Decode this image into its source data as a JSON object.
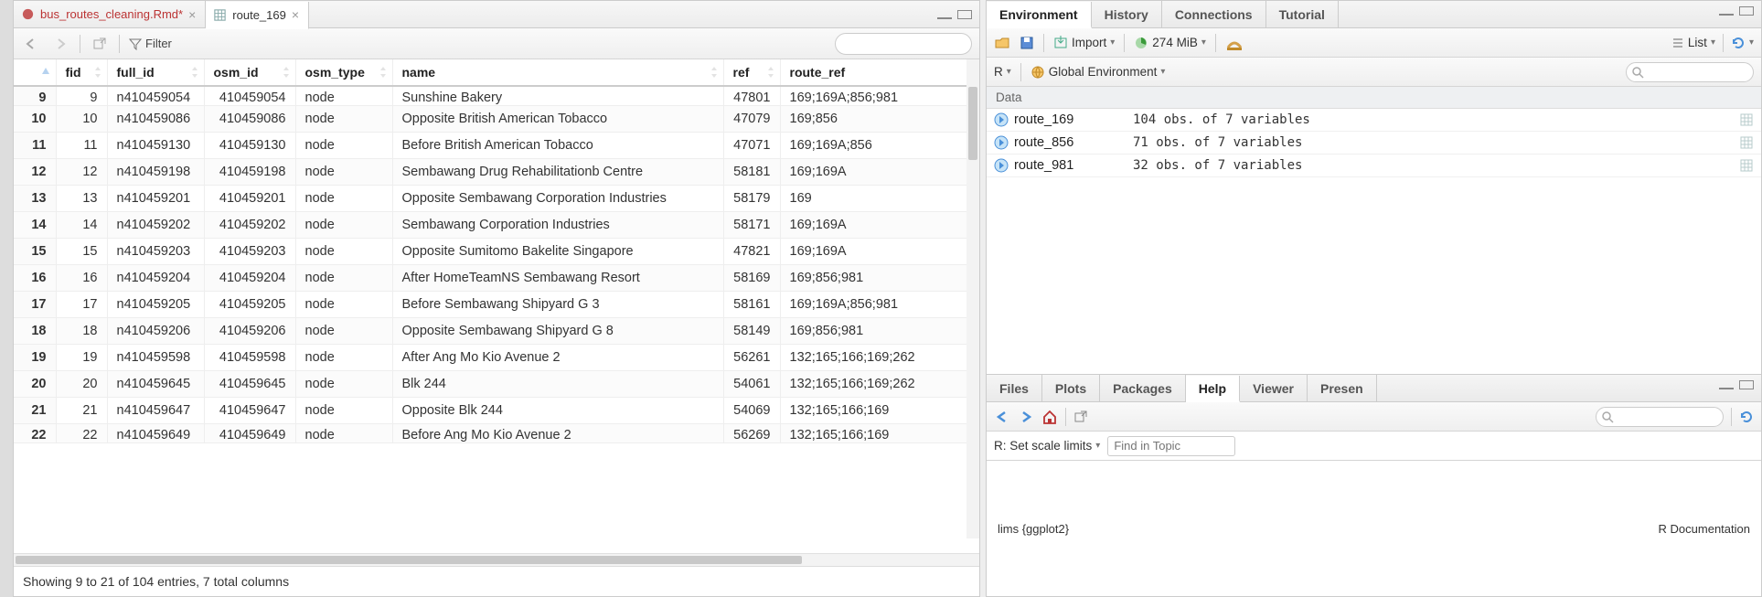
{
  "tabs": {
    "inactive_label": "bus_routes_cleaning.Rmd*",
    "active_label": "route_169"
  },
  "toolbar": {
    "filter_label": "Filter"
  },
  "table": {
    "columns": [
      "fid",
      "full_id",
      "osm_id",
      "osm_type",
      "name",
      "ref",
      "route_ref"
    ],
    "rows": [
      {
        "rn": "9",
        "fid": "9",
        "full_id": "n410459054",
        "osm_id": "410459054",
        "osm_type": "node",
        "name": "Sunshine Bakery",
        "ref": "47801",
        "route_ref": "169;169A;856;981"
      },
      {
        "rn": "10",
        "fid": "10",
        "full_id": "n410459086",
        "osm_id": "410459086",
        "osm_type": "node",
        "name": "Opposite British American Tobacco",
        "ref": "47079",
        "route_ref": "169;856"
      },
      {
        "rn": "11",
        "fid": "11",
        "full_id": "n410459130",
        "osm_id": "410459130",
        "osm_type": "node",
        "name": "Before British American Tobacco",
        "ref": "47071",
        "route_ref": "169;169A;856"
      },
      {
        "rn": "12",
        "fid": "12",
        "full_id": "n410459198",
        "osm_id": "410459198",
        "osm_type": "node",
        "name": "Sembawang Drug Rehabilitationb Centre",
        "ref": "58181",
        "route_ref": "169;169A"
      },
      {
        "rn": "13",
        "fid": "13",
        "full_id": "n410459201",
        "osm_id": "410459201",
        "osm_type": "node",
        "name": "Opposite Sembawang Corporation Industries",
        "ref": "58179",
        "route_ref": "169"
      },
      {
        "rn": "14",
        "fid": "14",
        "full_id": "n410459202",
        "osm_id": "410459202",
        "osm_type": "node",
        "name": "Sembawang Corporation Industries",
        "ref": "58171",
        "route_ref": "169;169A"
      },
      {
        "rn": "15",
        "fid": "15",
        "full_id": "n410459203",
        "osm_id": "410459203",
        "osm_type": "node",
        "name": "Opposite Sumitomo Bakelite Singapore",
        "ref": "47821",
        "route_ref": "169;169A"
      },
      {
        "rn": "16",
        "fid": "16",
        "full_id": "n410459204",
        "osm_id": "410459204",
        "osm_type": "node",
        "name": "After HomeTeamNS Sembawang Resort",
        "ref": "58169",
        "route_ref": "169;856;981"
      },
      {
        "rn": "17",
        "fid": "17",
        "full_id": "n410459205",
        "osm_id": "410459205",
        "osm_type": "node",
        "name": "Before Sembawang Shipyard G 3",
        "ref": "58161",
        "route_ref": "169;169A;856;981"
      },
      {
        "rn": "18",
        "fid": "18",
        "full_id": "n410459206",
        "osm_id": "410459206",
        "osm_type": "node",
        "name": "Opposite Sembawang Shipyard G 8",
        "ref": "58149",
        "route_ref": "169;856;981"
      },
      {
        "rn": "19",
        "fid": "19",
        "full_id": "n410459598",
        "osm_id": "410459598",
        "osm_type": "node",
        "name": "After Ang Mo Kio Avenue 2",
        "ref": "56261",
        "route_ref": "132;165;166;169;262"
      },
      {
        "rn": "20",
        "fid": "20",
        "full_id": "n410459645",
        "osm_id": "410459645",
        "osm_type": "node",
        "name": "Blk 244",
        "ref": "54061",
        "route_ref": "132;165;166;169;262"
      },
      {
        "rn": "21",
        "fid": "21",
        "full_id": "n410459647",
        "osm_id": "410459647",
        "osm_type": "node",
        "name": "Opposite Blk 244",
        "ref": "54069",
        "route_ref": "132;165;166;169"
      }
    ],
    "partial_row": {
      "rn": "22",
      "fid": "22",
      "full_id": "n410459649",
      "osm_id": "410459649",
      "osm_type": "node",
      "name": "Before Ang Mo Kio Avenue 2",
      "ref": "56269",
      "route_ref": "132;165;166;169"
    }
  },
  "status": "Showing 9 to 21 of 104 entries, 7 total columns",
  "env": {
    "tabs": [
      "Environment",
      "History",
      "Connections",
      "Tutorial"
    ],
    "import_label": "Import",
    "memory_label": "274 MiB",
    "list_label": "List",
    "scope_label": "R",
    "global_label": "Global Environment",
    "section": "Data",
    "items": [
      {
        "name": "route_169",
        "desc": "104 obs. of 7 variables"
      },
      {
        "name": "route_856",
        "desc": "71 obs. of 7 variables"
      },
      {
        "name": "route_981",
        "desc": "32 obs. of 7 variables"
      }
    ]
  },
  "br": {
    "tabs": [
      "Files",
      "Plots",
      "Packages",
      "Help",
      "Viewer",
      "Presen"
    ],
    "topic_label": "R: Set scale limits",
    "find_placeholder": "Find in Topic",
    "help_left": "lims {ggplot2}",
    "help_right": "R Documentation"
  }
}
